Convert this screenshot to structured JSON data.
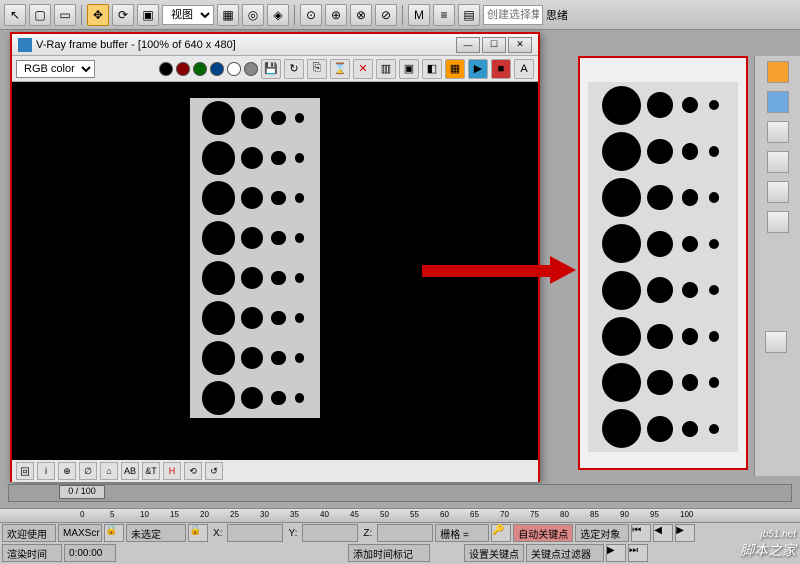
{
  "top_toolbar": {
    "view_dropdown": "视图",
    "create_select": "创建选择集",
    "sixuan": "思绪"
  },
  "vray": {
    "title": "V-Ray frame buffer - [100% of 640 x 480]",
    "color_mode": "RGB color",
    "bottom_buttons": [
      "回",
      "i",
      "⊕",
      "∅",
      "⌂",
      "AB",
      "&T",
      "H",
      "⟲",
      "↺"
    ]
  },
  "timeline": {
    "frame_label": "0 / 100"
  },
  "ruler_ticks": [
    "0",
    "5",
    "10",
    "15",
    "20",
    "25",
    "30",
    "35",
    "40",
    "45",
    "50",
    "55",
    "60",
    "65",
    "70",
    "75",
    "80",
    "85",
    "90",
    "95",
    "100"
  ],
  "status": {
    "welcome": "欢迎使用",
    "maxs": "MAXScr",
    "unselected": "未选定",
    "render_time": "渲染时间",
    "time_value": "0:00:00",
    "x_label": "X:",
    "y_label": "Y:",
    "z_label": "Z:",
    "grid": "栅格 = ",
    "add_time": "添加时间标记",
    "auto_key": "自动关键点",
    "set_key": "设置关键点",
    "selected_obj": "选定对象",
    "key_filter": "关键点过滤器"
  },
  "watermark": {
    "url": "jb51.net",
    "name": "脚本之家"
  },
  "colors": {
    "swatches": [
      "#000",
      "#800",
      "#060",
      "#048",
      "#fff",
      "#888",
      "#fc0",
      "#fc0"
    ]
  }
}
